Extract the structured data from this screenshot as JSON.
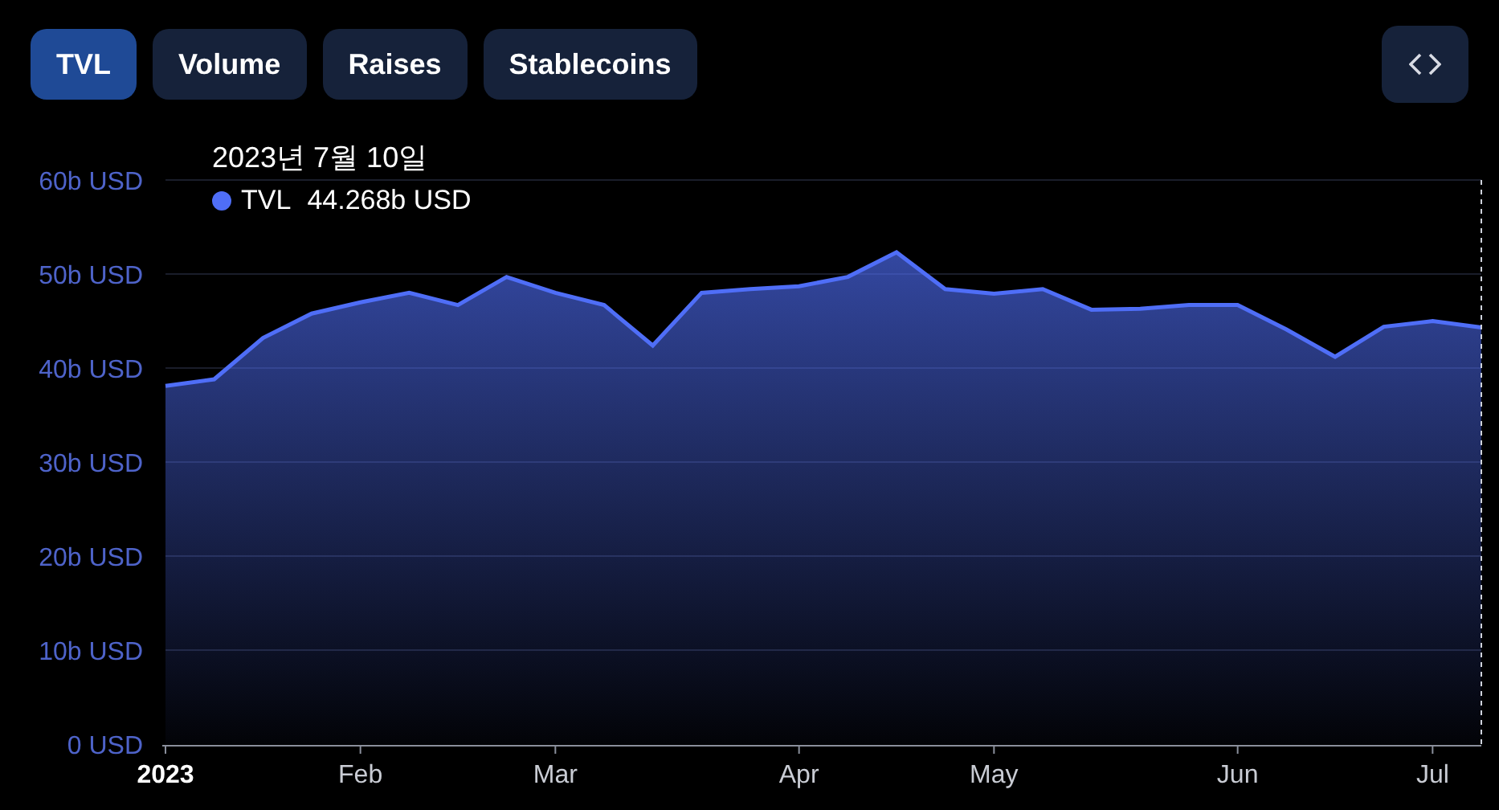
{
  "tabs": [
    {
      "label": "TVL",
      "selected": true
    },
    {
      "label": "Volume",
      "selected": false
    },
    {
      "label": "Raises",
      "selected": false
    },
    {
      "label": "Stablecoins",
      "selected": false
    }
  ],
  "chart": {
    "tooltip": {
      "date": "2023년 7월 10일",
      "value": "44.268b USD"
    },
    "chart_data": {
      "type": "area",
      "categories": [
        "2023",
        null,
        null,
        null,
        "Feb",
        null,
        null,
        null,
        "Mar",
        null,
        null,
        null,
        null,
        "Apr",
        null,
        null,
        null,
        "May",
        null,
        null,
        null,
        null,
        "Jun",
        null,
        null,
        null,
        "Jul",
        null
      ],
      "series": [
        {
          "name": "TVL",
          "color": "#4f6ef7",
          "values": [
            38.1,
            38.8,
            43.2,
            45.8,
            47.0,
            48.0,
            46.7,
            49.7,
            48.0,
            46.7,
            42.4,
            48.0,
            48.4,
            48.7,
            49.7,
            52.3,
            48.4,
            47.9,
            48.4,
            46.2,
            46.3,
            46.7,
            46.7,
            44.1,
            41.2,
            44.4,
            45.0,
            44.3
          ]
        }
      ],
      "ylim": [
        0,
        60
      ],
      "grid": true,
      "yticks": [
        {
          "value": 0,
          "label": "0 USD"
        },
        {
          "value": 10,
          "label": "10b USD"
        },
        {
          "value": 20,
          "label": "20b USD"
        },
        {
          "value": 30,
          "label": "30b USD"
        },
        {
          "value": 40,
          "label": "40b USD"
        },
        {
          "value": 50,
          "label": "50b USD"
        },
        {
          "value": 60,
          "label": "60b USD"
        }
      ]
    }
  }
}
